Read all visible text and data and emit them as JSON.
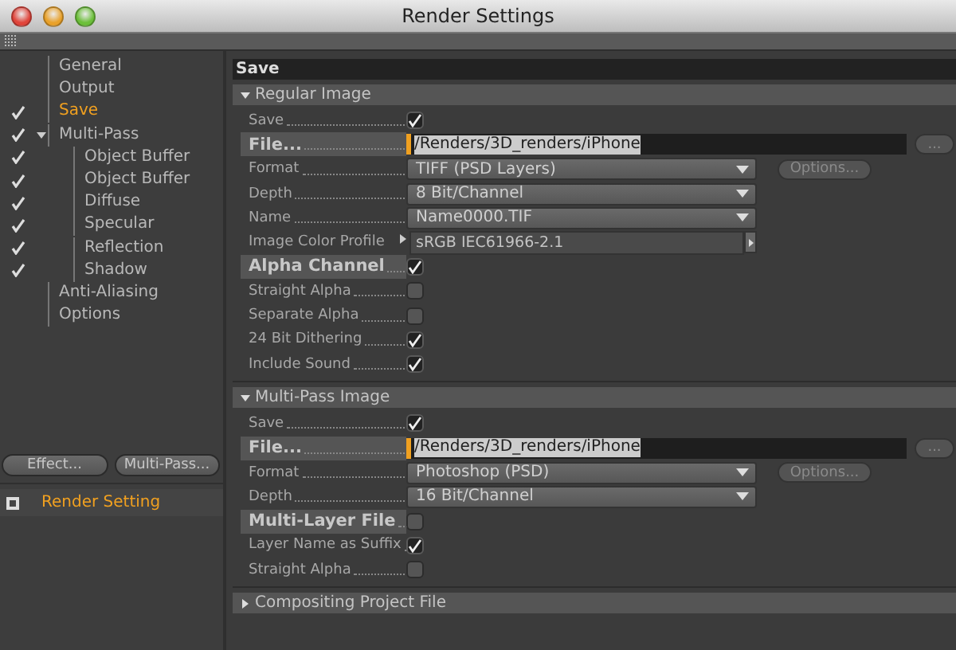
{
  "window": {
    "title": "Render Settings"
  },
  "sidebar": {
    "items": [
      {
        "label": "General",
        "checked": false,
        "selected": false
      },
      {
        "label": "Output",
        "checked": false,
        "selected": false
      },
      {
        "label": "Save",
        "checked": true,
        "selected": true
      },
      {
        "label": "Multi-Pass",
        "checked": true,
        "selected": false,
        "expanded": true,
        "children": [
          {
            "label": "Object Buffer",
            "checked": true,
            "selected": false
          },
          {
            "label": "Object Buffer",
            "checked": true,
            "selected": false
          },
          {
            "label": "Diffuse",
            "checked": true,
            "selected": false
          },
          {
            "label": "Specular",
            "checked": true,
            "selected": false
          },
          {
            "label": "Reflection",
            "checked": true,
            "selected": false
          },
          {
            "label": "Shadow",
            "checked": true,
            "selected": false
          }
        ]
      },
      {
        "label": "Anti-Aliasing",
        "checked": false,
        "selected": false
      },
      {
        "label": "Options",
        "checked": false,
        "selected": false
      }
    ],
    "buttons": [
      "Effect...",
      "Multi-Pass..."
    ],
    "render_settings": [
      {
        "label": "Render Setting",
        "selected": true
      }
    ]
  },
  "panel": {
    "title": "Save",
    "sections": [
      {
        "title": "Regular Image",
        "expanded": true,
        "rows": [
          {
            "kind": "checkbox",
            "label": "Save",
            "checked": true,
            "highlight": false
          },
          {
            "kind": "file",
            "label": "File...",
            "value": "/Renders/3D_renders/iPhone",
            "button": "...",
            "highlight": true
          },
          {
            "kind": "dropdown",
            "label": "Format",
            "value": "TIFF (PSD Layers)",
            "button": "Options...",
            "highlight": false
          },
          {
            "kind": "dropdown",
            "label": "Depth",
            "value": "8 Bit/Channel",
            "highlight": false
          },
          {
            "kind": "dropdown",
            "label": "Name",
            "value": "Name0000.TIF",
            "highlight": false
          },
          {
            "kind": "profile",
            "label": "Image Color Profile",
            "value": "sRGB IEC61966-2.1",
            "highlight": false
          },
          {
            "kind": "checkbox",
            "label": "Alpha Channel",
            "checked": true,
            "highlight": true
          },
          {
            "kind": "checkbox",
            "label": "Straight Alpha",
            "checked": false,
            "highlight": false
          },
          {
            "kind": "checkbox",
            "label": "Separate Alpha",
            "checked": false,
            "highlight": false
          },
          {
            "kind": "checkbox",
            "label": "24 Bit Dithering",
            "checked": true,
            "highlight": false
          },
          {
            "kind": "checkbox",
            "label": "Include Sound",
            "checked": true,
            "highlight": false
          }
        ]
      },
      {
        "title": "Multi-Pass Image",
        "expanded": true,
        "rows": [
          {
            "kind": "checkbox",
            "label": "Save",
            "checked": true,
            "highlight": false
          },
          {
            "kind": "file",
            "label": "File...",
            "value": "/Renders/3D_renders/iPhone",
            "button": "...",
            "highlight": true
          },
          {
            "kind": "dropdown",
            "label": "Format",
            "value": "Photoshop (PSD)",
            "button": "Options...",
            "highlight": false
          },
          {
            "kind": "dropdown",
            "label": "Depth",
            "value": "16 Bit/Channel",
            "highlight": false
          },
          {
            "kind": "checkbox",
            "label": "Multi-Layer File",
            "checked": false,
            "highlight": true
          },
          {
            "kind": "checkbox",
            "label": "Layer Name as Suffix",
            "checked": true,
            "highlight": false
          },
          {
            "kind": "checkbox",
            "label": "Straight Alpha",
            "checked": false,
            "highlight": false
          }
        ]
      },
      {
        "title": "Compositing Project File",
        "expanded": false
      }
    ]
  }
}
